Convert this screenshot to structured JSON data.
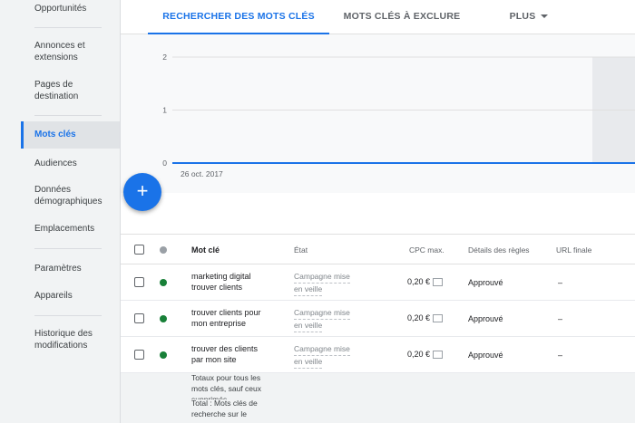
{
  "sidebar": {
    "items": [
      {
        "label": "Opportunités"
      },
      {
        "label": "Annonces et\nextensions"
      },
      {
        "label": "Pages de\ndestination"
      },
      {
        "label": "Mots clés"
      },
      {
        "label": "Audiences"
      },
      {
        "label": "Données\ndémographiques"
      },
      {
        "label": "Emplacements"
      },
      {
        "label": "Paramètres"
      },
      {
        "label": "Appareils"
      },
      {
        "label": "Historique des\nmodifications"
      }
    ]
  },
  "tabs": {
    "search": "RECHERCHER DES MOTS CLÉS",
    "exclude": "MOTS CLÉS À EXCLURE",
    "more": "PLUS"
  },
  "chart_data": {
    "type": "line",
    "x": [
      "26 oct. 2017"
    ],
    "series": [
      {
        "values": [
          0
        ]
      }
    ],
    "yticks": [
      "2",
      "1",
      "0"
    ],
    "ylim": [
      0,
      2
    ],
    "xlabel": "26 oct. 2017",
    "color": "#1a73e8"
  },
  "fab": {
    "label": "+"
  },
  "table": {
    "headers": {
      "keyword": "Mot clé",
      "state": "État",
      "cpc": "CPC max.",
      "rules": "Détails des règles",
      "url": "URL finale"
    },
    "rows": [
      {
        "keyword": "marketing digital\ntrouver clients",
        "state1": "Campagne mise",
        "state2": "en veille",
        "cpc": "0,20 €",
        "rules": "Approuvé",
        "url": "–"
      },
      {
        "keyword": "trouver clients pour\nmon entreprise",
        "state1": "Campagne mise",
        "state2": "en veille",
        "cpc": "0,20 €",
        "rules": "Approuvé",
        "url": "–"
      },
      {
        "keyword": "trouver des clients\npar mon site",
        "state1": "Campagne mise",
        "state2": "en veille",
        "cpc": "0,20 €",
        "rules": "Approuvé",
        "url": "–"
      }
    ],
    "totals": {
      "line1": "Totaux pour tous les\nmots clés, sauf ceux\nsupprimés",
      "line2": "Total : Mots clés de\nrecherche sur le"
    }
  },
  "colors": {
    "accent": "#1a73e8",
    "status_green": "#188038"
  }
}
